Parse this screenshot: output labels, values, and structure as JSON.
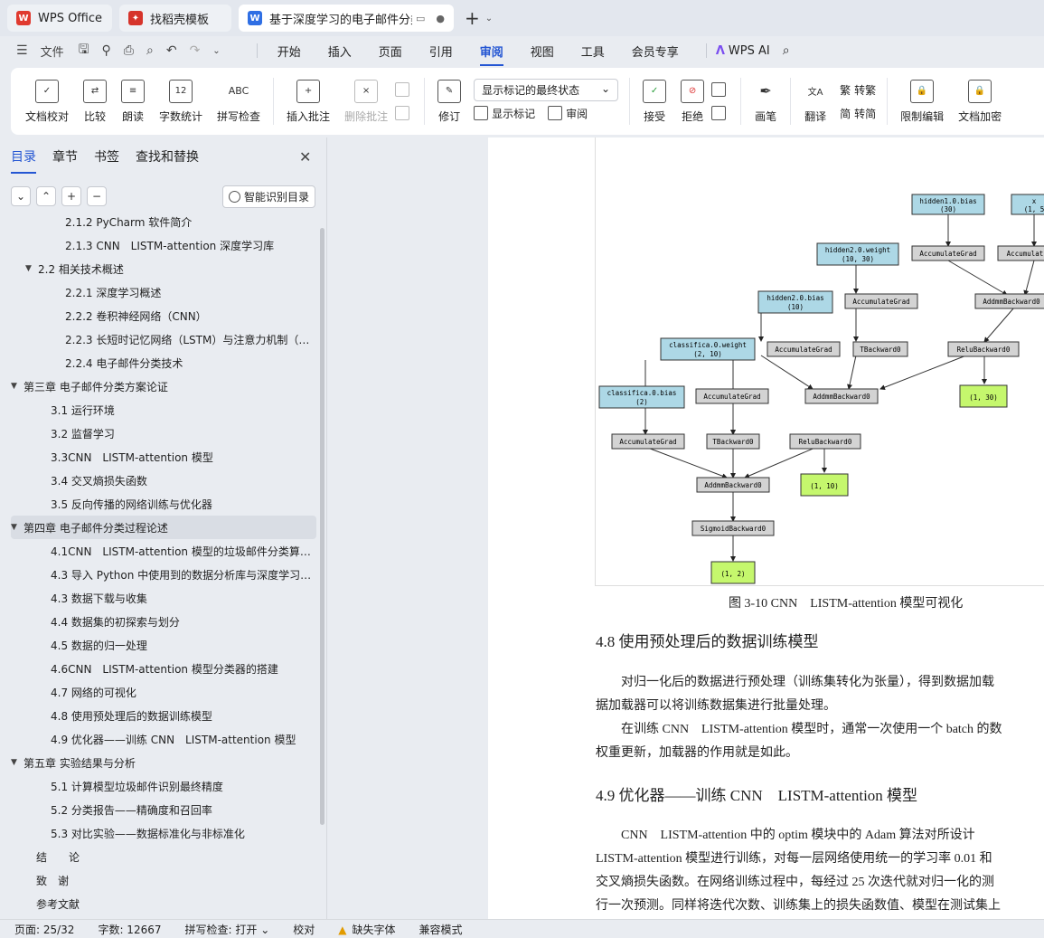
{
  "tabs": [
    {
      "label": "WPS Office"
    },
    {
      "label": "找稻壳模板"
    },
    {
      "label": "基于深度学习的电子邮件分类"
    }
  ],
  "menu": {
    "file": "文件",
    "items": [
      "开始",
      "插入",
      "页面",
      "引用",
      "审阅",
      "视图",
      "工具",
      "会员专享"
    ],
    "active": "审阅",
    "wps_ai": "WPS AI"
  },
  "ribbon": {
    "proofread": "文档校对",
    "compare": "比较",
    "read_aloud": "朗读",
    "word_count": "字数统计",
    "word_count_icon": "12",
    "spell_check": "拼写检查",
    "spell_icon": "ABC",
    "insert_comment": "插入批注",
    "delete_comment": "删除批注",
    "revise": "修订",
    "display_mode": "显示标记的最终状态",
    "show_markup": "显示标记",
    "review": "审阅",
    "accept": "接受",
    "reject": "拒绝",
    "pen": "画笔",
    "translate": "翻译",
    "to_traditional": "转繁",
    "to_simplified": "转简",
    "restrict_edit": "限制编辑",
    "doc_encrypt": "文档加密"
  },
  "nav": {
    "tabs": [
      "目录",
      "章节",
      "书签",
      "查找和替换"
    ],
    "smart_btn": "智能识别目录",
    "toc": [
      {
        "level": 3,
        "label": "2.1.2 PyCharm 软件简介"
      },
      {
        "level": 3,
        "label": "2.1.3 CNN　LISTM-attention 深度学习库"
      },
      {
        "level": 2,
        "label": "2.2  相关技术概述",
        "expanded": true
      },
      {
        "level": 3,
        "label": "2.2.1  深度学习概述"
      },
      {
        "level": 3,
        "label": "2.2.2  卷积神经网络（CNN）"
      },
      {
        "level": 3,
        "label": "2.2.3  长短时记忆网络（LSTM）与注意力机制（…"
      },
      {
        "level": 3,
        "label": "2.2.4  电子邮件分类技术"
      },
      {
        "level": 1,
        "label": "第三章  电子邮件分类方案论证",
        "expanded": true
      },
      {
        "level": 2,
        "label": "3.1 运行环境"
      },
      {
        "level": 2,
        "label": "3.2 监督学习"
      },
      {
        "level": 2,
        "label": "3.3CNN　LISTM-attention 模型"
      },
      {
        "level": 2,
        "label": "3.4 交叉熵损失函数"
      },
      {
        "level": 2,
        "label": "3.5 反向传播的网络训练与优化器"
      },
      {
        "level": 1,
        "label": "第四章  电子邮件分类过程论述",
        "expanded": true,
        "selected": true
      },
      {
        "level": 2,
        "label": "4.1CNN　LISTM-attention 模型的垃圾邮件分类算…"
      },
      {
        "level": 2,
        "label": "4.3 导入 Python 中使用到的数据分析库与深度学习…"
      },
      {
        "level": 2,
        "label": "4.3 数据下载与收集"
      },
      {
        "level": 2,
        "label": "4.4 数据集的初探索与划分"
      },
      {
        "level": 2,
        "label": "4.5 数据的归一处理"
      },
      {
        "level": 2,
        "label": "4.6CNN　LISTM-attention 模型分类器的搭建"
      },
      {
        "level": 2,
        "label": "4.7 网络的可视化"
      },
      {
        "level": 2,
        "label": "4.8 使用预处理后的数据训练模型"
      },
      {
        "level": 2,
        "label": "4.9 优化器——训练 CNN　LISTM-attention 模型"
      },
      {
        "level": 1,
        "label": "第五章  实验结果与分析",
        "expanded": true
      },
      {
        "level": 2,
        "label": "5.1 计算模型垃圾邮件识别最终精度"
      },
      {
        "level": 2,
        "label": "5.2 分类报告——精确度和召回率"
      },
      {
        "level": 2,
        "label": "5.3 对比实验——数据标准化与非标准化"
      },
      {
        "level": 1,
        "label": "结　　论"
      },
      {
        "level": 1,
        "label": "致　谢"
      },
      {
        "level": 1,
        "label": "参考文献"
      }
    ]
  },
  "document": {
    "graph_nodes": {
      "hidden1_bias": "hidden1.0.bias",
      "hidden1_bias_shape": "(30)",
      "x": "x",
      "x_shape": "(1, 5",
      "hidden2_weight": "hidden2.0.weight",
      "hidden2_weight_shape": "(10, 30)",
      "accum_grad": "AccumulateGrad",
      "accum_short": "Accumulat",
      "hidden2_bias": "hidden2.0.bias",
      "hidden2_bias_shape": "(10)",
      "addmm_backward": "AddmmBackward0",
      "classifica_weight": "classifica.0.weight",
      "classifica_weight_shape": "(2, 10)",
      "t_backward": "TBackward0",
      "relu_backward": "ReluBackward0",
      "classifica_bias": "classifica.0.bias",
      "classifica_bias_shape": "(2)",
      "out_30": "(1, 30)",
      "out_10": "(1, 10)",
      "sigmoid_backward": "SigmoidBackward0",
      "out_2": "(1, 2)"
    },
    "caption": "图 3-10 CNN　LISTM-attention 模型可视化",
    "h_48": "4.8 使用预处理后的数据训练模型",
    "p1_line1": "对归一化后的数据进行预处理（训练集转化为张量），得到数据加载",
    "p1_line2": "据加载器可以将训练数据集进行批量处理。",
    "p2_line1": "在训练 CNN　LISTM-attention 模型时，通常一次使用一个 batch 的数",
    "p2_line2": "权重更新，加载器的作用就是如此。",
    "h_49": "4.9 优化器——训练 CNN　LISTM-attention 模型",
    "p3_line1": "CNN　LISTM-attention 中的 optim 模块中的 Adam 算法对所设计",
    "p3_line2": "LISTM-attention 模型进行训练，对每一层网络使用统一的学习率 0.01 和",
    "p3_line3": "交叉熵损失函数。在网络训练过程中，每经过 25 次迭代就对归一化的测",
    "p3_line4": "行一次预测。同样将迭代次数、训练集上的损失函数值、模型在测试集上"
  },
  "status": {
    "page": "页面: 25/32",
    "words": "字数: 12667",
    "spell": "拼写检查: 打开",
    "proof": "校对",
    "missing_font": "缺失字体",
    "compat": "兼容模式"
  }
}
